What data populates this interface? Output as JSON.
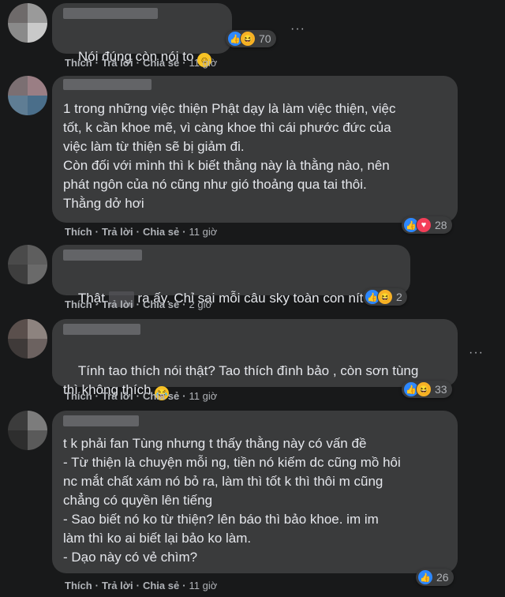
{
  "actions": {
    "like": "Thích",
    "reply": "Trả lời",
    "share": "Chia sẻ",
    "separator": "·"
  },
  "comments": [
    {
      "text": "Nói đúng còn nói to",
      "time": "11 giờ",
      "reaction_count": "70",
      "reactions": [
        "like",
        "haha"
      ]
    },
    {
      "text": "1 trong những việc thiện Phật dạy là làm việc thiện, việc\ntốt, k cần khoe mẽ, vì càng khoe thì cái phước đức của\nviệc làm từ thiện sẽ bị giảm đi.\nCòn đối với mình thì k biết thằng này là thằng nào, nên\nphát ngôn của nó cũng như gió thoảng qua tai thôi.\nThằng dở hơi",
      "time": "11 giờ",
      "reaction_count": "28",
      "reactions": [
        "like",
        "love"
      ]
    },
    {
      "text_start": "Thật",
      "text_end": "ra ấy. Chỉ sai mỗi câu sky toàn con nít thôi",
      "time": "2 giờ",
      "reaction_count": "2",
      "reactions": [
        "like",
        "haha"
      ]
    },
    {
      "text": "Tính tao thích nói thật? Tao thích đình bảo , còn sơn tùng\nthì không thích",
      "time": "11 giờ",
      "reaction_count": "33",
      "reactions": [
        "like",
        "haha"
      ]
    },
    {
      "text": "t k phải fan Tùng nhưng t thấy thằng này có vấn đề\n- Từ thiện là chuyện mỗi ng, tiền nó kiếm dc cũng mồ hôi\nnc mắt chất xám nó bỏ ra, làm thì tốt k thì thôi m cũng\nchẳng có quyền lên tiếng\n- Sao biết nó ko từ thiện? lên báo thì bảo khoe. im im\nlàm thì ko ai biết lại bảo ko làm.\n- Dạo này có vẻ chìm?",
      "time": "11 giờ",
      "reaction_count": "26",
      "reactions": [
        "like"
      ]
    }
  ],
  "more_icon": "···",
  "colors": {
    "background": "#18191a",
    "bubble": "#3a3b3c",
    "text": "#e4e6eb",
    "muted": "#b0b3b8",
    "like": "#2d88ff",
    "haha": "#f7b125",
    "love": "#f33e58"
  }
}
